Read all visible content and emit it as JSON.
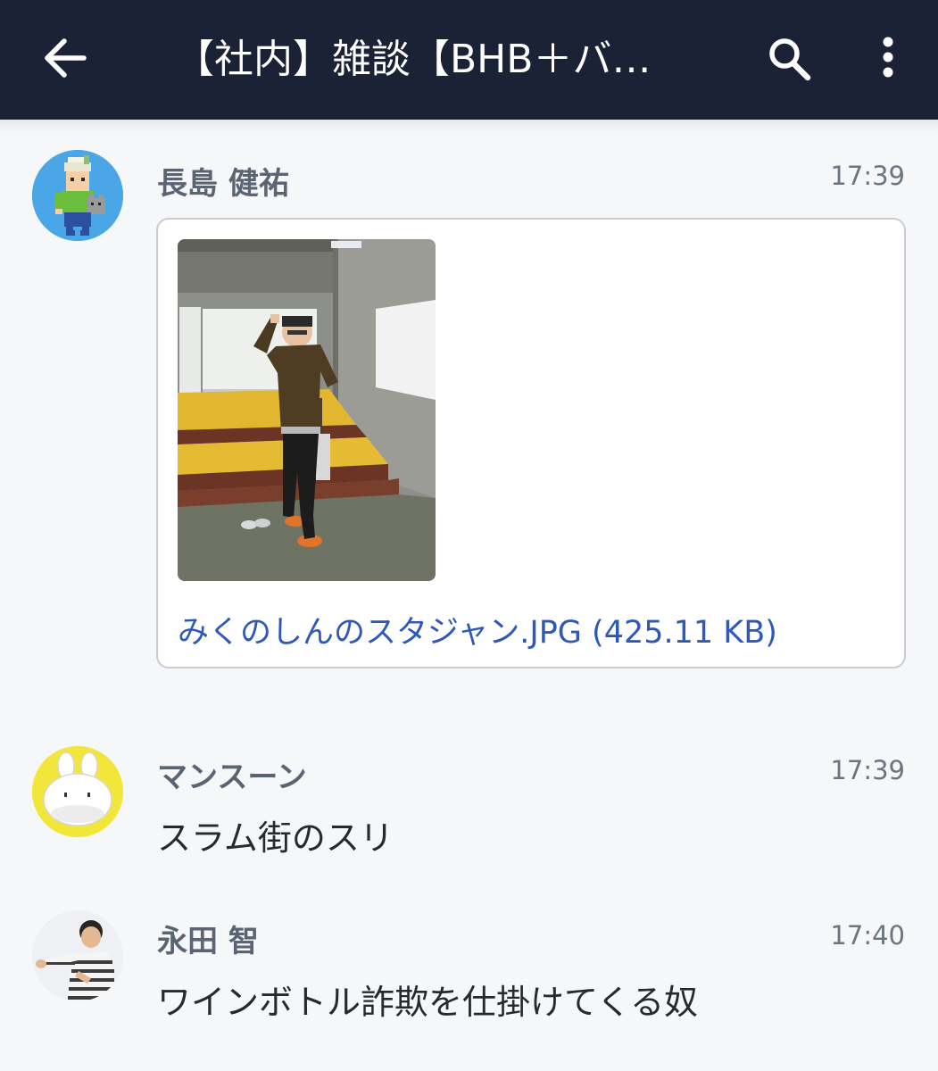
{
  "header": {
    "title": "【社内】雑談【BHB＋バ…",
    "back_icon": "arrow-left-icon",
    "search_icon": "search-icon",
    "more_icon": "more-vertical-icon",
    "background_color": "#1b2236"
  },
  "messages": [
    {
      "sender": "長島 健祐",
      "time": "17:39",
      "avatar_icon": "pixel-character-avatar",
      "attachment": {
        "file_label": "みくのしんのスタジャン.JPG (425.11 KB)"
      }
    },
    {
      "sender": "マンスーン",
      "time": "17:39",
      "avatar_icon": "rabbit-avatar",
      "text": "スラム街のスリ"
    },
    {
      "sender": "永田 智",
      "time": "17:40",
      "avatar_icon": "person-photo-avatar",
      "text": "ワインボトル詐欺を仕掛けてくる奴"
    }
  ],
  "colors": {
    "link": "#2f59b8",
    "sender": "#5a6472",
    "body_text": "#262a30",
    "background": "#f6f7f9"
  }
}
